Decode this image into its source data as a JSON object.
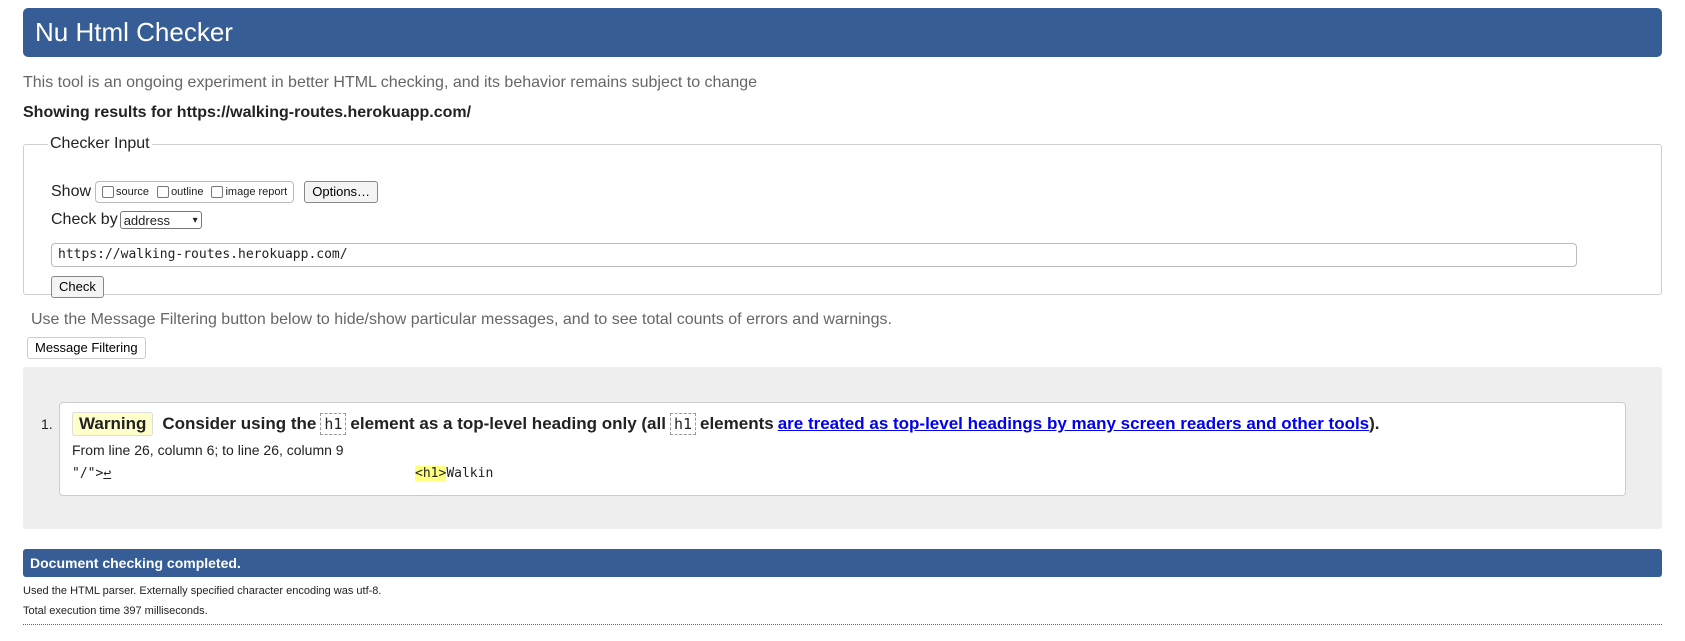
{
  "header": {
    "title": "Nu Html Checker"
  },
  "intro": "This tool is an ongoing experiment in better HTML checking, and its behavior remains subject to change",
  "showing": {
    "prefix": "Showing results for ",
    "url": "https://walking-routes.herokuapp.com/"
  },
  "checker": {
    "legend": "Checker Input",
    "show_label": "Show",
    "options": [
      "source",
      "outline",
      "image report"
    ],
    "options_button": "Options…",
    "check_by_label": "Check by",
    "check_by_value": "address",
    "url_value": "https://walking-routes.herokuapp.com/",
    "check_button": "Check"
  },
  "filter": {
    "hint": "Use the Message Filtering button below to hide/show particular messages, and to see total counts of errors and warnings.",
    "button": "Message Filtering"
  },
  "messages": [
    {
      "number": "1.",
      "type": "Warning",
      "text_before": "Consider using the",
      "code1": "h1",
      "text_middle": "element as a top-level heading only (all",
      "code2": "h1",
      "text_after": "elements",
      "link": "are treated as top-level headings by many screen readers and other tools",
      "text_end": ").",
      "location": "From line 26, column 6; to line 26, column 9",
      "extract_pre": "\"/\">",
      "extract_lf": "↩",
      "extract_tag": "<h1>",
      "extract_post": "Walkin"
    }
  ],
  "footer": {
    "done": "Document checking completed.",
    "parser_note": "Used the HTML parser. Externally specified character encoding was utf-8.",
    "exec_time": "Total execution time 397 milliseconds."
  },
  "colors": {
    "brand": "#365d95",
    "warning_bg": "#ffffcc",
    "highlight": "#ffff80",
    "link": "#0000ee"
  }
}
